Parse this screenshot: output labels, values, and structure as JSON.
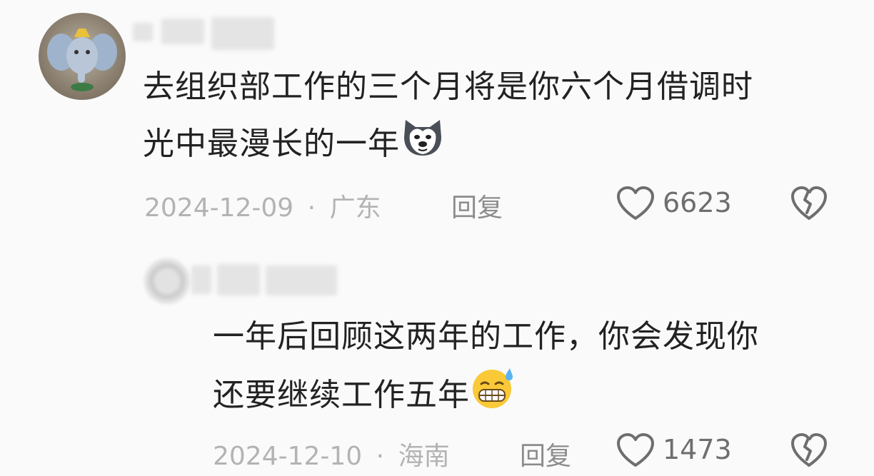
{
  "comments": [
    {
      "text_line1": "去组织部工作的三个月将是你六个月借调时",
      "text_line2": "光中最漫长的一年",
      "emoji": "dog-face-icon",
      "date": "2024-12-09",
      "separator": "·",
      "location": "广东",
      "reply_label": "回复",
      "like_count": "6623"
    },
    {
      "text_line1": "一年后回顾这两年的工作，你会发现你",
      "text_line2": "还要继续工作五年",
      "emoji": "grimace-sweat-icon",
      "date": "2024-12-10",
      "separator": "·",
      "location": "海南",
      "reply_label": "回复",
      "like_count": "1473"
    }
  ],
  "colors": {
    "background": "#fafafa",
    "text": "#222222",
    "meta": "#b3b3b3",
    "icon": "#6e6e6e"
  }
}
